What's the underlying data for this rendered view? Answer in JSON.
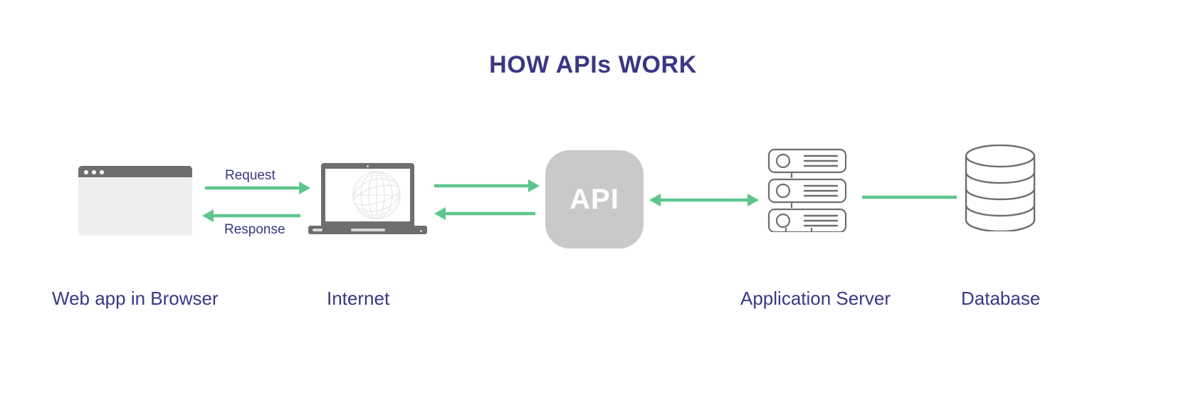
{
  "diagram": {
    "title": "HOW APIs WORK",
    "background_color": "#ffffff",
    "accent_color": "#5ec68c",
    "text_color": "#3b3784",
    "icon_gray": "#6e6e6e"
  },
  "nodes": {
    "browser": {
      "label": "Web app in Browser",
      "icon": "browser-window-icon",
      "titlebar_color": "#6e6e6e",
      "body_color": "#eeeeee",
      "dots": 3
    },
    "internet": {
      "label": "Internet",
      "icon": "laptop-globe-icon",
      "frame_color": "#6e6e6e",
      "screen_color": "#ffffff"
    },
    "api": {
      "label": "API",
      "icon": "api-rounded-square-icon",
      "box_color": "#c9c9c9",
      "label_color": "#ffffff"
    },
    "app_server": {
      "label": "Application Server",
      "icon": "server-stack-icon",
      "units": 3,
      "outline_color": "#6e6e6e"
    },
    "database": {
      "label": "Database",
      "icon": "database-cylinder-icon",
      "discs": 4,
      "outline_color": "#6e6e6e"
    }
  },
  "connections": {
    "request": {
      "caption": "Request",
      "from": "browser",
      "to": "internet",
      "direction": "right",
      "color": "#5ec68c"
    },
    "response": {
      "caption": "Response",
      "from": "internet",
      "to": "browser",
      "direction": "left",
      "color": "#5ec68c"
    },
    "internet_to_api": {
      "caption": "",
      "from": "internet",
      "to": "api",
      "direction": "right",
      "color": "#5ec68c"
    },
    "api_to_internet": {
      "caption": "",
      "from": "api",
      "to": "internet",
      "direction": "left",
      "color": "#5ec68c"
    },
    "api_to_server": {
      "caption": "",
      "from": "api",
      "to": "app_server",
      "direction": "both",
      "color": "#5ec68c"
    },
    "server_to_database": {
      "caption": "",
      "from": "app_server",
      "to": "database",
      "direction": "none",
      "color": "#5ec68c"
    }
  }
}
